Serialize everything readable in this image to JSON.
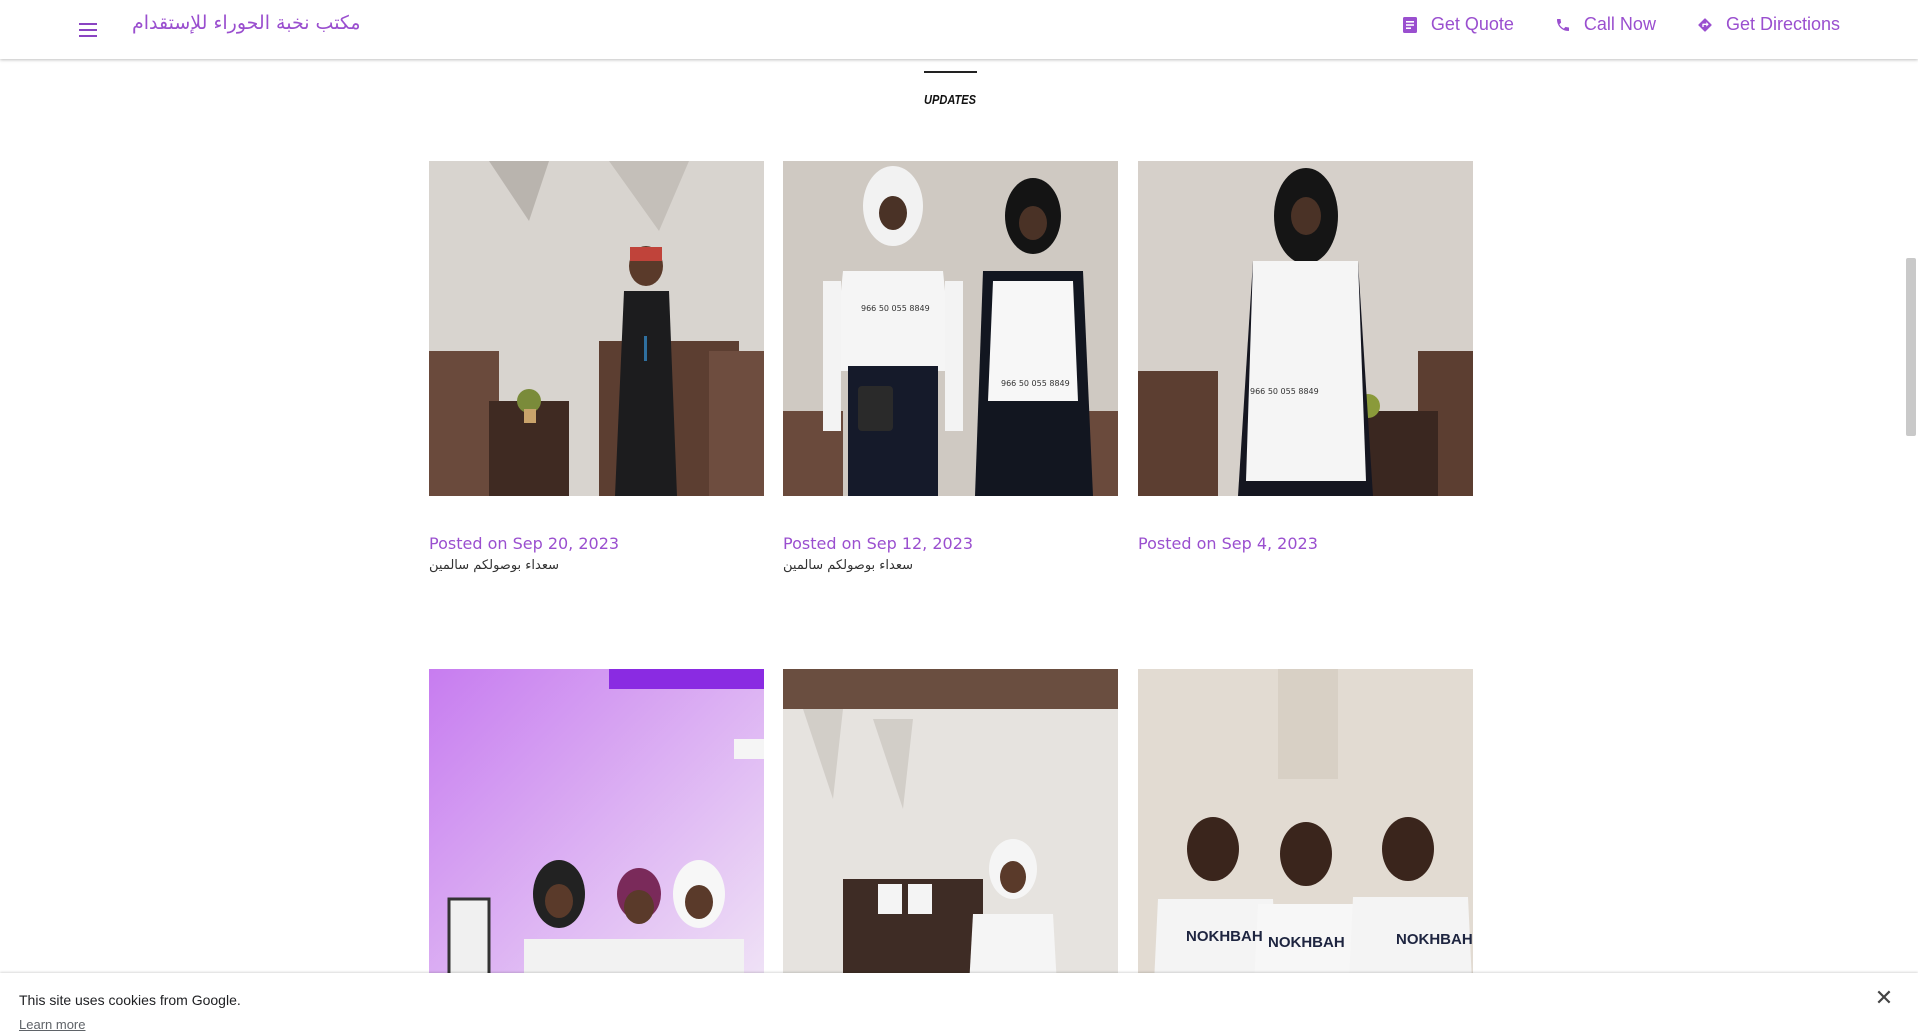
{
  "header": {
    "brand": "مكتب نخبة الحوراء للإستقدام",
    "menu_icon": "menu-icon",
    "actions": [
      {
        "label": "Get Quote",
        "icon": "quote-icon"
      },
      {
        "label": "Call Now",
        "icon": "phone-icon"
      },
      {
        "label": "Get Directions",
        "icon": "directions-icon"
      }
    ],
    "accent": "#9a4fcf"
  },
  "section": {
    "title": "UPDATES"
  },
  "posts": [
    {
      "date": "Posted on Sep 20, 2023",
      "text": "سعداء بوصولكم سالمين"
    },
    {
      "date": "Posted on Sep 12, 2023",
      "text": "سعداء بوصولكم سالمين"
    },
    {
      "date": "Posted on Sep 4, 2023",
      "text": ""
    }
  ],
  "photo_text": {
    "vest_phone": "966 50 055 8849",
    "shirt": "NOKHBAH"
  },
  "cookie": {
    "text": "This site uses cookies from Google.",
    "link": "Learn more",
    "close_icon": "close-icon"
  }
}
